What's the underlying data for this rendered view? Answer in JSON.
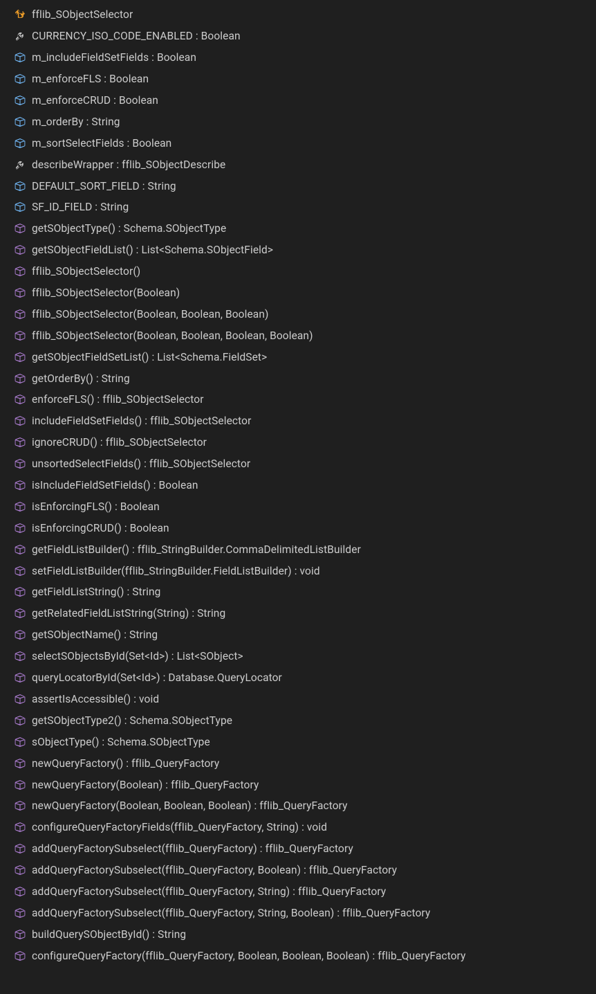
{
  "outline": [
    {
      "icon": "class",
      "label": "fflib_SObjectSelector"
    },
    {
      "icon": "property",
      "label": "CURRENCY_ISO_CODE_ENABLED : Boolean"
    },
    {
      "icon": "field",
      "label": "m_includeFieldSetFields : Boolean"
    },
    {
      "icon": "field",
      "label": "m_enforceFLS : Boolean"
    },
    {
      "icon": "field",
      "label": "m_enforceCRUD : Boolean"
    },
    {
      "icon": "field",
      "label": "m_orderBy : String"
    },
    {
      "icon": "field",
      "label": "m_sortSelectFields : Boolean"
    },
    {
      "icon": "property",
      "label": "describeWrapper : fflib_SObjectDescribe"
    },
    {
      "icon": "field",
      "label": "DEFAULT_SORT_FIELD : String"
    },
    {
      "icon": "field",
      "label": "SF_ID_FIELD : String"
    },
    {
      "icon": "method",
      "label": "getSObjectType() : Schema.SObjectType"
    },
    {
      "icon": "method",
      "label": "getSObjectFieldList() : List<Schema.SObjectField>"
    },
    {
      "icon": "method",
      "label": "fflib_SObjectSelector()"
    },
    {
      "icon": "method",
      "label": "fflib_SObjectSelector(Boolean)"
    },
    {
      "icon": "method",
      "label": "fflib_SObjectSelector(Boolean, Boolean, Boolean)"
    },
    {
      "icon": "method",
      "label": "fflib_SObjectSelector(Boolean, Boolean, Boolean, Boolean)"
    },
    {
      "icon": "method",
      "label": "getSObjectFieldSetList() : List<Schema.FieldSet>"
    },
    {
      "icon": "method",
      "label": "getOrderBy() : String"
    },
    {
      "icon": "method",
      "label": "enforceFLS() : fflib_SObjectSelector"
    },
    {
      "icon": "method",
      "label": "includeFieldSetFields() : fflib_SObjectSelector"
    },
    {
      "icon": "method",
      "label": "ignoreCRUD() : fflib_SObjectSelector"
    },
    {
      "icon": "method",
      "label": "unsortedSelectFields() : fflib_SObjectSelector"
    },
    {
      "icon": "method",
      "label": "isIncludeFieldSetFields() : Boolean"
    },
    {
      "icon": "method",
      "label": "isEnforcingFLS() : Boolean"
    },
    {
      "icon": "method",
      "label": "isEnforcingCRUD() : Boolean"
    },
    {
      "icon": "method",
      "label": "getFieldListBuilder() : fflib_StringBuilder.CommaDelimitedListBuilder"
    },
    {
      "icon": "method",
      "label": "setFieldListBuilder(fflib_StringBuilder.FieldListBuilder) : void"
    },
    {
      "icon": "method",
      "label": "getFieldListString() : String"
    },
    {
      "icon": "method",
      "label": "getRelatedFieldListString(String) : String"
    },
    {
      "icon": "method",
      "label": "getSObjectName() : String"
    },
    {
      "icon": "method",
      "label": "selectSObjectsById(Set<Id>) : List<SObject>"
    },
    {
      "icon": "method",
      "label": "queryLocatorById(Set<Id>) : Database.QueryLocator"
    },
    {
      "icon": "method",
      "label": "assertIsAccessible() : void"
    },
    {
      "icon": "method",
      "label": "getSObjectType2() : Schema.SObjectType"
    },
    {
      "icon": "method",
      "label": "sObjectType() : Schema.SObjectType"
    },
    {
      "icon": "method",
      "label": "newQueryFactory() : fflib_QueryFactory"
    },
    {
      "icon": "method",
      "label": "newQueryFactory(Boolean) : fflib_QueryFactory"
    },
    {
      "icon": "method",
      "label": "newQueryFactory(Boolean, Boolean, Boolean) : fflib_QueryFactory"
    },
    {
      "icon": "method",
      "label": "configureQueryFactoryFields(fflib_QueryFactory, String) : void"
    },
    {
      "icon": "method",
      "label": "addQueryFactorySubselect(fflib_QueryFactory) : fflib_QueryFactory"
    },
    {
      "icon": "method",
      "label": "addQueryFactorySubselect(fflib_QueryFactory, Boolean) : fflib_QueryFactory"
    },
    {
      "icon": "method",
      "label": "addQueryFactorySubselect(fflib_QueryFactory, String) : fflib_QueryFactory"
    },
    {
      "icon": "method",
      "label": "addQueryFactorySubselect(fflib_QueryFactory, String, Boolean) : fflib_QueryFactory"
    },
    {
      "icon": "method",
      "label": "buildQuerySObjectById() : String"
    },
    {
      "icon": "method",
      "label": "configureQueryFactory(fflib_QueryFactory, Boolean, Boolean, Boolean) : fflib_QueryFactory"
    }
  ]
}
